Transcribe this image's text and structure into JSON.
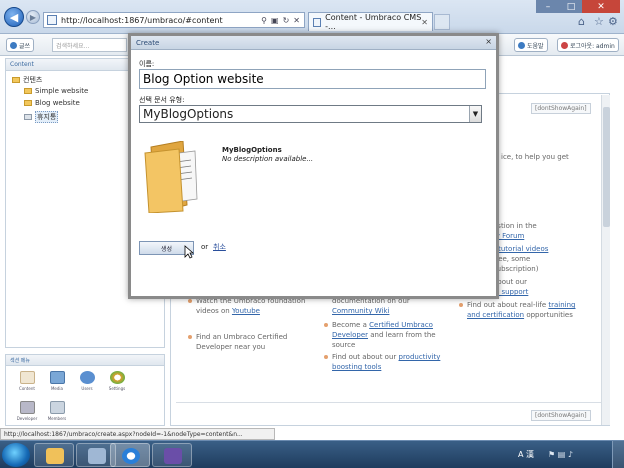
{
  "browser": {
    "address": "http://localhost:1867/umbraco/#content",
    "tab_title": "Content - Umbraco CMS -...",
    "status_url": "http://localhost:1867/umbraco/create.aspx?nodeId=-1&nodeType=content&n..."
  },
  "toolbar": {
    "left_button": "글쓰",
    "search_placeholder": "검색하세요...",
    "help_button": "도움말",
    "logout_button": "로그아웃: admin"
  },
  "tree": {
    "header": "Content",
    "root": "컨텐츠",
    "items": [
      "Simple website",
      "Blog website"
    ],
    "recycle": "휴지통"
  },
  "sections": {
    "header": "섹션 메뉴",
    "items": [
      "Content",
      "Media",
      "Users",
      "Settings",
      "Developer",
      "Members"
    ]
  },
  "content": {
    "dont_show_again": "[dontShowAgain]",
    "frag1": "ice, to help you get",
    "frag2": "estion in the",
    "frag2_link": "ty Forum",
    "frag3": "r",
    "frag3_link": "tutorial videos",
    "frag4": "free, some",
    "frag5": "subscription)",
    "frag6": "about our",
    "frag6_link": "al support",
    "col1_b1_text": "Watch the Umbraco foundation videos on",
    "col1_b1_link": "Youtube",
    "col1_b2_text": "Find an Umbraco Certified Developer near you",
    "col2_top_text": "documentation on our",
    "col2_top_link": "Community Wiki",
    "col2_b1_text": "Become a",
    "col2_b1_link": "Certified Umbraco Developer",
    "col2_b1_tail": "and learn from the source",
    "col2_b2_text": "Find out about our",
    "col2_b2_link": "productivity boosting tools",
    "col3_b1_text": "Find out about real-life",
    "col3_b1_link": "training and certification",
    "col3_b1_tail": "opportunities"
  },
  "modal": {
    "title": "Create",
    "name_label": "이름:",
    "name_value": "Blog Option website",
    "doctype_label": "선택 문서 유형:",
    "doctype_selected": "MyBlogOptions",
    "doctype_name": "MyBlogOptions",
    "doctype_desc": "No description available...",
    "create_button": "생성",
    "or_text": "or",
    "cancel_link": "취소"
  },
  "taskbar": {
    "lang": "A 漢"
  }
}
